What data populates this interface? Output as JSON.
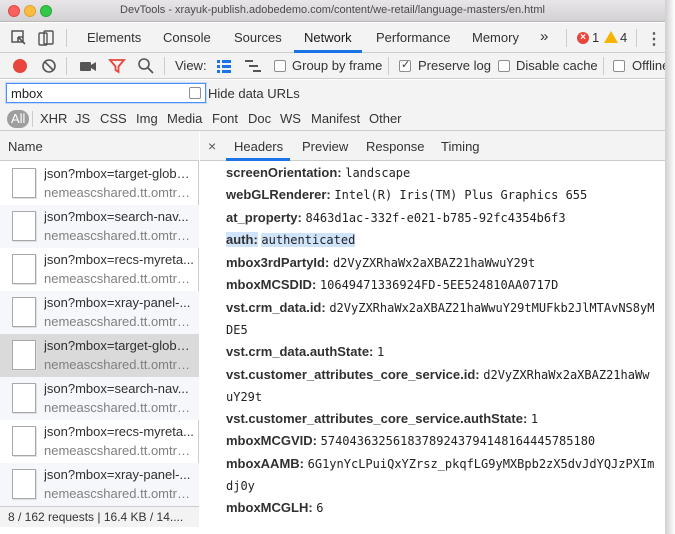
{
  "window": {
    "title": "DevTools - xrayuk-publish.adobedemo.com/content/we-retail/language-masters/en.html"
  },
  "main_tabs": [
    {
      "label": "Elements"
    },
    {
      "label": "Console"
    },
    {
      "label": "Sources"
    },
    {
      "label": "Network"
    },
    {
      "label": "Performance"
    },
    {
      "label": "Memory"
    }
  ],
  "more_tabs_glyph": "»",
  "badges": {
    "errors": "1",
    "warnings": "4"
  },
  "toolbar": {
    "view_label": "View:",
    "group_by_frame_label": "Group by frame",
    "preserve_log_label": "Preserve log",
    "disable_cache_label": "Disable cache",
    "offline_label": "Offline",
    "group_by_frame_checked": false,
    "preserve_log_checked": true,
    "disable_cache_checked": false
  },
  "filter": {
    "value": "mbox",
    "hide_data_urls_label": "Hide data URLs"
  },
  "type_filters": [
    {
      "label": "All",
      "active": true
    },
    {
      "label": "XHR"
    },
    {
      "label": "JS"
    },
    {
      "label": "CSS"
    },
    {
      "label": "Img"
    },
    {
      "label": "Media"
    },
    {
      "label": "Font"
    },
    {
      "label": "Doc"
    },
    {
      "label": "WS"
    },
    {
      "label": "Manifest"
    },
    {
      "label": "Other"
    }
  ],
  "requests": {
    "column_header": "Name",
    "items": [
      {
        "name": "json?mbox=target-globa...",
        "domain": "nemeascshared.tt.omtrd..."
      },
      {
        "name": "json?mbox=search-nav...",
        "domain": "nemeascshared.tt.omtrd..."
      },
      {
        "name": "json?mbox=recs-myreta...",
        "domain": "nemeascshared.tt.omtrd..."
      },
      {
        "name": "json?mbox=xray-panel-...",
        "domain": "nemeascshared.tt.omtrd..."
      },
      {
        "name": "json?mbox=target-globa...",
        "domain": "nemeascshared.tt.omtrd..."
      },
      {
        "name": "json?mbox=search-nav...",
        "domain": "nemeascshared.tt.omtrd..."
      },
      {
        "name": "json?mbox=recs-myreta...",
        "domain": "nemeascshared.tt.omtrd..."
      },
      {
        "name": "json?mbox=xray-panel-...",
        "domain": "nemeascshared.tt.omtrd..."
      }
    ],
    "selected_index": 4,
    "status": "8 / 162 requests | 16.4 KB / 14...."
  },
  "detail_tabs": [
    {
      "label": "Headers"
    },
    {
      "label": "Preview"
    },
    {
      "label": "Response"
    },
    {
      "label": "Timing"
    }
  ],
  "close_glyph": "×",
  "headers": [
    {
      "key": "screenOrientation:",
      "value": "landscape"
    },
    {
      "key": "webGLRenderer:",
      "value": "Intel(R) Iris(TM) Plus Graphics 655"
    },
    {
      "key": "at_property:",
      "value": "8463d1ac-332f-e021-b785-92fc4354b6f3"
    },
    {
      "key": "auth:",
      "value": "authenticated",
      "highlight": true
    },
    {
      "key": "mbox3rdPartyId:",
      "value": "d2VyZXRhaWx2aXBAZ21haWwuY29t"
    },
    {
      "key": "mboxMCSDID:",
      "value": "10649471336924FD-5EE524810AA0717D"
    },
    {
      "key": "vst.crm_data.id:",
      "value": "d2VyZXRhaWx2aXBAZ21haWwuY29tMUFkb2JlMTAvNS8yMDE5"
    },
    {
      "key": "vst.crm_data.authState:",
      "value": "1"
    },
    {
      "key": "vst.customer_attributes_core_service.id:",
      "value": "d2VyZXRhaWx2aXBAZ21haWwuY29t"
    },
    {
      "key": "vst.customer_attributes_core_service.authState:",
      "value": "1"
    },
    {
      "key": "mboxMCGVID:",
      "value": "57404363256183789243794148164445785180"
    },
    {
      "key": "mboxAAMB:",
      "value": "6G1ynYcLPuiQxYZrsz_pkqfLG9yMXBpb2zX5dvJdYQJzPXImdj0y"
    },
    {
      "key": "mboxMCGLH:",
      "value": "6"
    }
  ]
}
